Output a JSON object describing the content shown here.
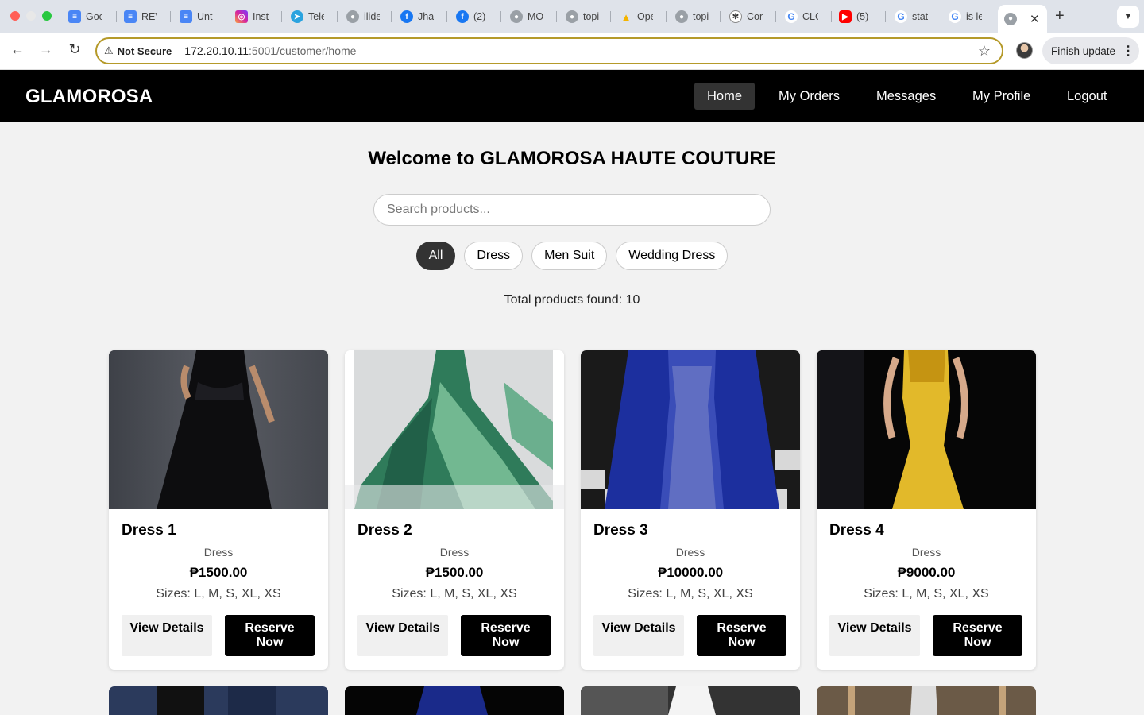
{
  "browser": {
    "tabs": [
      {
        "title": "Goo",
        "icon": "google-docs-icon"
      },
      {
        "title": "REV",
        "icon": "google-docs-icon"
      },
      {
        "title": "Unti",
        "icon": "google-docs-icon"
      },
      {
        "title": "Insta",
        "icon": "instagram-icon"
      },
      {
        "title": "Tele",
        "icon": "telegram-icon"
      },
      {
        "title": "ilide",
        "icon": "globe-icon"
      },
      {
        "title": "Jha",
        "icon": "facebook-icon"
      },
      {
        "title": "(2)",
        "icon": "facebook-icon"
      },
      {
        "title": "MOI",
        "icon": "globe-icon"
      },
      {
        "title": "topi",
        "icon": "globe-icon"
      },
      {
        "title": "Ope",
        "icon": "google-drive-icon"
      },
      {
        "title": "topi",
        "icon": "globe-icon"
      },
      {
        "title": "Con",
        "icon": "chatgpt-icon"
      },
      {
        "title": "CLC",
        "icon": "google-icon"
      },
      {
        "title": "(5)",
        "icon": "youtube-icon"
      },
      {
        "title": "stat",
        "icon": "google-icon"
      },
      {
        "title": "is le",
        "icon": "google-icon"
      }
    ],
    "security_label": "Not Secure",
    "url_host": "172.20.10.11",
    "url_path": ":5001/customer/home",
    "finish_update_label": "Finish update"
  },
  "site": {
    "brand": "GLAMOROSA",
    "nav": [
      "Home",
      "My Orders",
      "Messages",
      "My Profile",
      "Logout"
    ],
    "welcome": "Welcome to GLAMOROSA HAUTE COUTURE",
    "search_placeholder": "Search products...",
    "filters": [
      "All",
      "Dress",
      "Men Suit",
      "Wedding Dress"
    ],
    "active_filter": "All",
    "total_label": "Total products found: 10"
  },
  "products": [
    {
      "name": "Dress 1",
      "category": "Dress",
      "price": "₱1500.00",
      "sizes": "Sizes: L, M, S, XL, XS",
      "view_label": "View Details",
      "reserve_label": "Reserve Now"
    },
    {
      "name": "Dress 2",
      "category": "Dress",
      "price": "₱1500.00",
      "sizes": "Sizes: L, M, S, XL, XS",
      "view_label": "View Details",
      "reserve_label": "Reserve Now"
    },
    {
      "name": "Dress 3",
      "category": "Dress",
      "price": "₱10000.00",
      "sizes": "Sizes: L, M, S, XL, XS",
      "view_label": "View Details",
      "reserve_label": "Reserve Now"
    },
    {
      "name": "Dress 4",
      "category": "Dress",
      "price": "₱9000.00",
      "sizes": "Sizes: L, M, S, XL, XS",
      "view_label": "View Details",
      "reserve_label": "Reserve Now"
    }
  ],
  "colors": {
    "header_bg": "#000000",
    "active_nav_bg": "#333333",
    "page_bg": "#f2f2f2",
    "omnibox_border": "#b59a2a"
  }
}
